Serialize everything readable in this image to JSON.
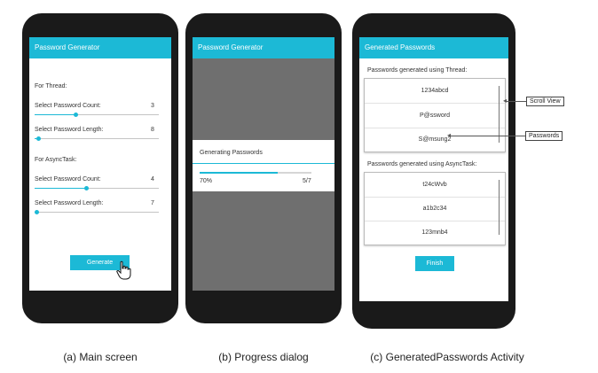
{
  "main_screen": {
    "title": "Password Generator",
    "thread_heading": "For Thread:",
    "thread_count_label": "Select Password Count:",
    "thread_count_value": "3",
    "thread_length_label": "Select Password Length:",
    "thread_length_value": "8",
    "async_heading": "For AsyncTask:",
    "async_count_label": "Select Password Count:",
    "async_count_value": "4",
    "async_length_label": "Select Password Length:",
    "async_length_value": "7",
    "generate_label": "Generate"
  },
  "progress_screen": {
    "title": "Password Generator",
    "dialog_title": "Generating Passwords",
    "percent": "70%",
    "count": "5/7",
    "progress_fraction": 0.7
  },
  "generated_screen": {
    "title": "Generated Passwords",
    "thread_heading": "Passwords generated using Thread:",
    "thread_passwords": [
      "1234abcd",
      "P@ssword",
      "S@msung2"
    ],
    "async_heading": "Passwords generated using AsyncTask:",
    "async_passwords": [
      "t24cWvb",
      "a1b2c34",
      "123mnb4"
    ],
    "finish_label": "Finish",
    "callout_scroll": "Scroll View",
    "callout_passwords": "Passwords"
  },
  "captions": {
    "a": "(a) Main screen",
    "b": "(b) Progress dialog",
    "c": "(c) GeneratedPasswords Activity"
  },
  "colors": {
    "accent": "#1cb9d6",
    "phone_body": "#1a1a1a",
    "overlay": "#6f6f6f"
  }
}
